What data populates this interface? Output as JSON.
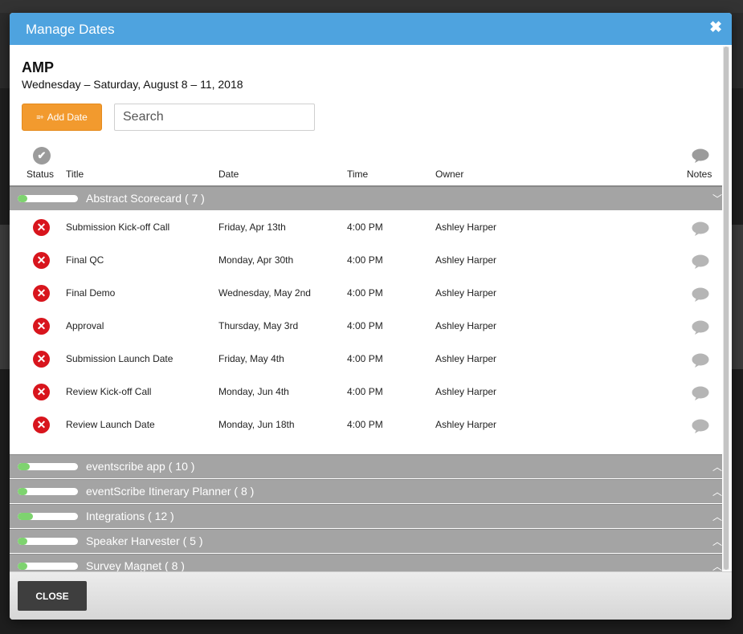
{
  "modal": {
    "title": "Manage Dates",
    "close_symbol": "✖"
  },
  "event": {
    "name": "AMP",
    "dates": "Wednesday – Saturday, August 8 – 11, 2018"
  },
  "toolbar": {
    "add_date_label": "Add Date",
    "add_date_icon": "list-plus-icon",
    "search_placeholder": "Search"
  },
  "columns": {
    "status": "Status",
    "title": "Title",
    "date": "Date",
    "time": "Time",
    "owner": "Owner",
    "notes": "Notes"
  },
  "groups": [
    {
      "label": "Abstract Scorecard ( 7 )",
      "progress": 0.1,
      "expanded": true
    },
    {
      "label": "eventscribe app ( 10 )",
      "progress": 0.2,
      "expanded": false
    },
    {
      "label": "eventScribe Itinerary Planner ( 8 )",
      "progress": 0.12,
      "expanded": false
    },
    {
      "label": "Integrations ( 12 )",
      "progress": 0.25,
      "expanded": false
    },
    {
      "label": "Speaker Harvester ( 5 )",
      "progress": 0.1,
      "expanded": false
    },
    {
      "label": "Survey Magnet ( 8 )",
      "progress": 0.15,
      "expanded": false
    }
  ],
  "rows": [
    {
      "title": "Submission Kick-off Call",
      "date": "Friday, Apr 13th",
      "time": "4:00 PM",
      "owner": "Ashley Harper"
    },
    {
      "title": "Final QC",
      "date": "Monday, Apr 30th",
      "time": "4:00 PM",
      "owner": "Ashley Harper"
    },
    {
      "title": "Final Demo",
      "date": "Wednesday, May 2nd",
      "time": "4:00 PM",
      "owner": "Ashley Harper"
    },
    {
      "title": "Approval",
      "date": "Thursday, May 3rd",
      "time": "4:00 PM",
      "owner": "Ashley Harper"
    },
    {
      "title": "Submission Launch Date",
      "date": "Friday, May 4th",
      "time": "4:00 PM",
      "owner": "Ashley Harper"
    },
    {
      "title": "Review Kick-off Call",
      "date": "Monday, Jun 4th",
      "time": "4:00 PM",
      "owner": "Ashley Harper"
    },
    {
      "title": "Review Launch Date",
      "date": "Monday, Jun 18th",
      "time": "4:00 PM",
      "owner": "Ashley Harper"
    }
  ],
  "footer": {
    "close_label": "CLOSE"
  },
  "colors": {
    "header": "#4ea3df",
    "add_button": "#f29a2e",
    "group_bar": "#a4a4a4",
    "progress": "#7ed36f",
    "incomplete_status": "#d8151d"
  }
}
